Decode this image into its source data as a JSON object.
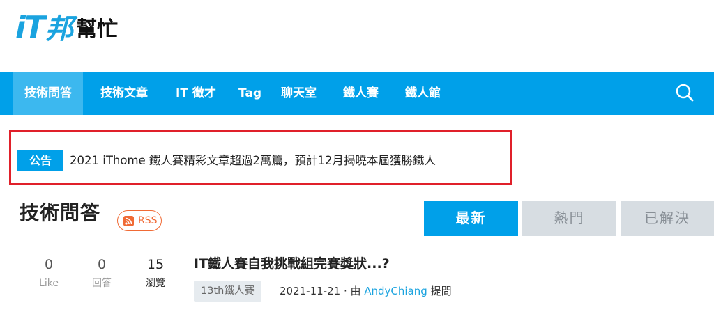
{
  "logo": {
    "it": "iT",
    "bang": "邦",
    "help": "幫忙"
  },
  "nav": {
    "items": [
      {
        "label": "技術問答",
        "active": true
      },
      {
        "label": "技術文章",
        "active": false
      },
      {
        "label": "IT 徵才",
        "active": false
      },
      {
        "label": "Tag",
        "active": false
      },
      {
        "label": "聊天室",
        "active": false
      },
      {
        "label": "鐵人賽",
        "active": false
      },
      {
        "label": "鐵人館",
        "active": false
      }
    ],
    "search_icon": "search-icon"
  },
  "announcement": {
    "badge": "公告",
    "text": "2021 iThome 鐵人賽精彩文章超過2萬篇，預計12月揭曉本屆獲勝鐵人"
  },
  "section": {
    "title": "技術問答",
    "rss_label": "RSS"
  },
  "tabs": [
    {
      "label": "最新",
      "active": true
    },
    {
      "label": "熱門",
      "active": false
    },
    {
      "label": "已解決",
      "active": false
    }
  ],
  "questions": [
    {
      "likes": "0",
      "likes_label": "Like",
      "answers": "0",
      "answers_label": "回答",
      "views": "15",
      "views_label": "瀏覽",
      "title": "IT鐵人賽自我挑戰組完賽獎狀...?",
      "tag": "13th鐵人賽",
      "date": "2021-11-21 · 由 ",
      "author": "AndyChiang",
      "action": " 提問"
    }
  ],
  "colors": {
    "brand": "#00a0e9",
    "nav_active": "#3cb8ef",
    "announce_border": "#e0202a",
    "rss": "#f06a35",
    "tab_inactive": "#d7dde2",
    "link": "#1aa3df"
  }
}
